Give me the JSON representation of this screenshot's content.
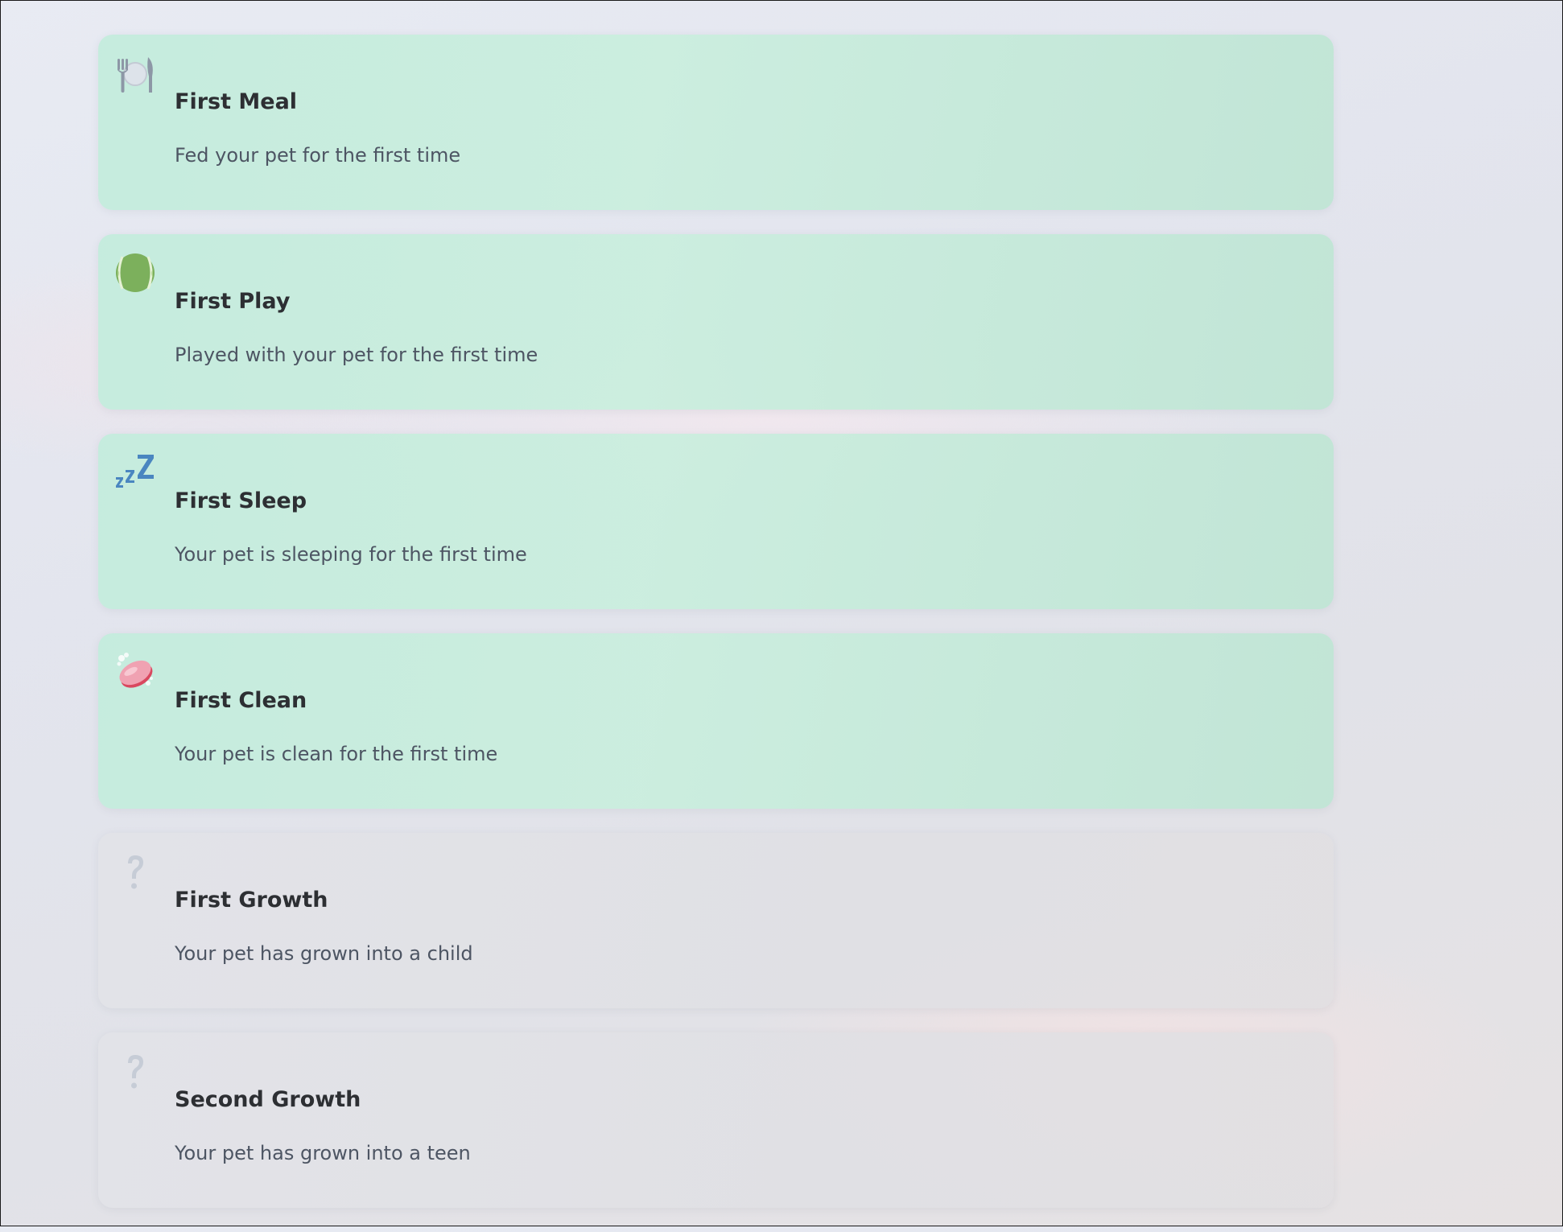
{
  "achievements": [
    {
      "title": "First Meal",
      "description": "Fed your pet for the first time",
      "icon": "fork-knife-plate-icon",
      "unlocked": true
    },
    {
      "title": "First Play",
      "description": "Played with your pet for the first time",
      "icon": "tennis-ball-icon",
      "unlocked": true
    },
    {
      "title": "First Sleep",
      "description": "Your pet is sleeping for the first time",
      "icon": "zzz-sleep-icon",
      "unlocked": true
    },
    {
      "title": "First Clean",
      "description": "Your pet is clean for the first time",
      "icon": "soap-icon",
      "unlocked": true
    },
    {
      "title": "First Growth",
      "description": "Your pet has grown into a child",
      "icon": "question-mark-icon",
      "unlocked": false
    },
    {
      "title": "Second Growth",
      "description": "Your pet has grown into a teen",
      "icon": "question-mark-icon",
      "unlocked": false
    }
  ],
  "colors": {
    "unlocked_card": "#c5ecdc",
    "locked_card": "#e2e3e8",
    "title_text": "#2d2f33",
    "description_text": "#4d5563"
  }
}
